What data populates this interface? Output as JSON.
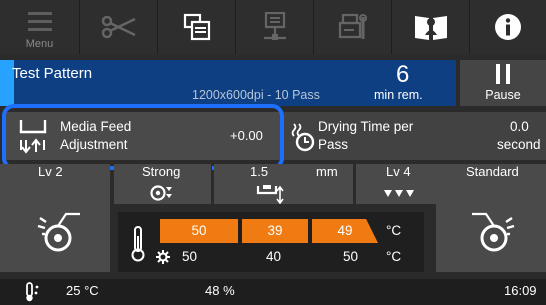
{
  "toolbar": {
    "menu_label": "Menu"
  },
  "job": {
    "title": "Test Pattern",
    "detail": "1200x600dpi - 10 Pass",
    "minutes": "6",
    "minutes_unit": "min rem.",
    "progress_fraction": 0.03
  },
  "pause": {
    "label": "Pause"
  },
  "media_feed": {
    "line1": "Media Feed",
    "line2": "Adjustment",
    "value": "+0.00"
  },
  "drying": {
    "line1": "Drying Time per",
    "line2": "Pass",
    "value": "0.0",
    "unit": "second"
  },
  "settings": {
    "col1": "Lv 2",
    "col2": "Strong",
    "col3": "1.5",
    "col3_unit": "mm",
    "col4": "Lv 4",
    "col5": "Standard"
  },
  "heaters": {
    "set": [
      "50",
      "39",
      "49"
    ],
    "set_unit": "°C",
    "actual": [
      "50",
      "40",
      "50"
    ],
    "actual_unit": "°C"
  },
  "status": {
    "temperature": "25 °C",
    "humidity": "48 %",
    "time": "16:09"
  },
  "colors": {
    "job_bar": "#0d3f82",
    "progress": "#27a3ff",
    "heater_bar": "#ef7b12",
    "highlight": "#1f6fff"
  }
}
